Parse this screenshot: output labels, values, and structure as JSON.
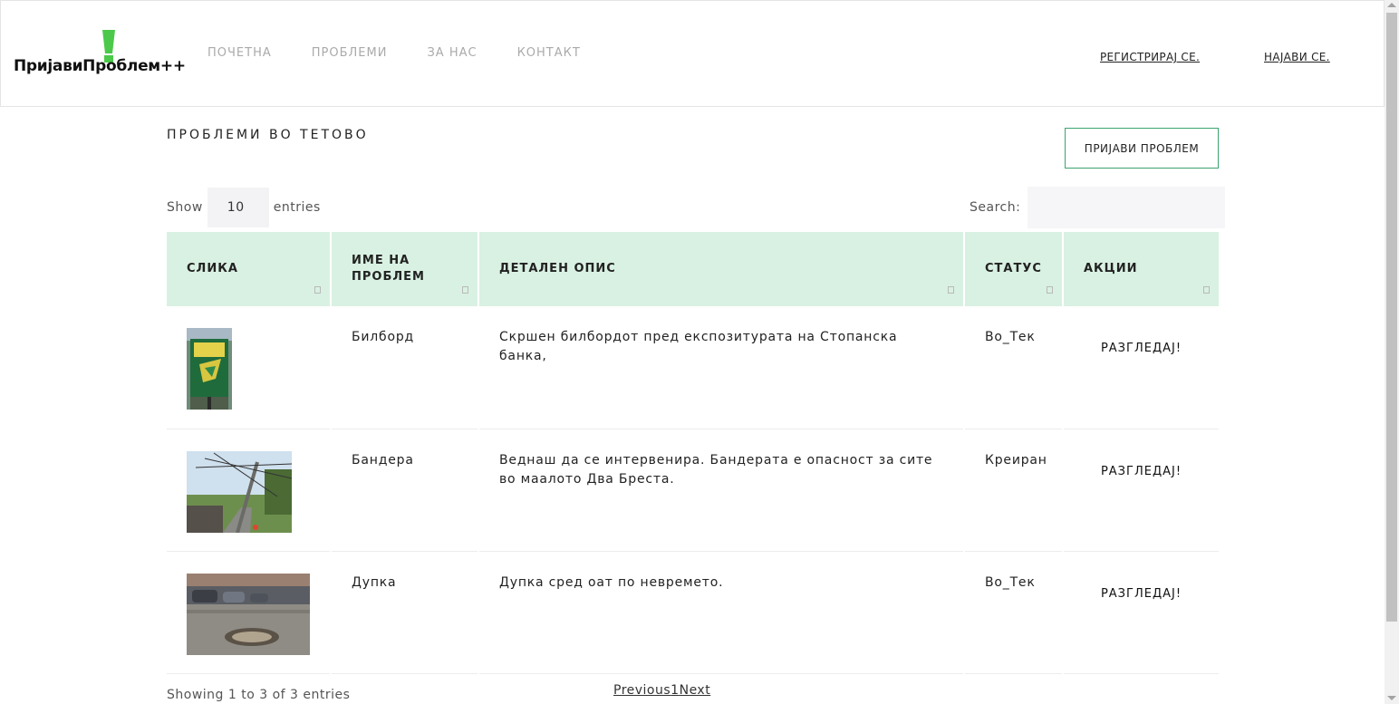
{
  "header": {
    "logo_text": "ПријавиПроблем++",
    "nav": [
      "ПОЧЕТНА",
      "ПРОБЛЕМИ",
      "ЗА НАС",
      "КОНТАКТ"
    ],
    "register_label": "РЕГИСТРИРАЈ СЕ.",
    "login_label": "НАЈАВИ СЕ."
  },
  "page": {
    "title": "ПРОБЛЕМИ ВО ТЕТОВО",
    "report_button": "ПРИЈАВИ ПРОБЛЕМ"
  },
  "table_controls": {
    "show_label": "Show",
    "show_value": "10",
    "entries_label": "entries",
    "search_label": "Search:",
    "search_value": ""
  },
  "table": {
    "headers": [
      "СЛИКА",
      "ИМЕ НА ПРОБЛЕМ",
      "ДЕТАЛЕН ОПИС",
      "СТАТУС",
      "АКЦИИ"
    ],
    "rows": [
      {
        "image": "billboard-photo",
        "name": "Билборд",
        "description": "Скршен билбордот пред експозитурата на Стопанска банка,",
        "status": "Во_Тек",
        "action": "РАЗГЛЕДАЈ!"
      },
      {
        "image": "utility-pole-photo",
        "name": "Бандера",
        "description": "Веднаш да се интервенира. Бандерата е опасност за сите во маалото Два Бреста.",
        "status": "Креиран",
        "action": "РАЗГЛЕДАЈ!"
      },
      {
        "image": "pothole-photo",
        "name": "Дупка",
        "description": "Дупка сред оат по невремето.",
        "status": "Во_Тек",
        "action": "РАЗГЛЕДАЈ!"
      }
    ]
  },
  "footer": {
    "info": "Showing 1 to 3 of 3 entries",
    "previous": "Previous",
    "page": "1",
    "next": "Next"
  },
  "colors": {
    "header_bg": "#d9f1e2",
    "accent": "#3aa56f",
    "nav_text": "#aaaaaa"
  }
}
